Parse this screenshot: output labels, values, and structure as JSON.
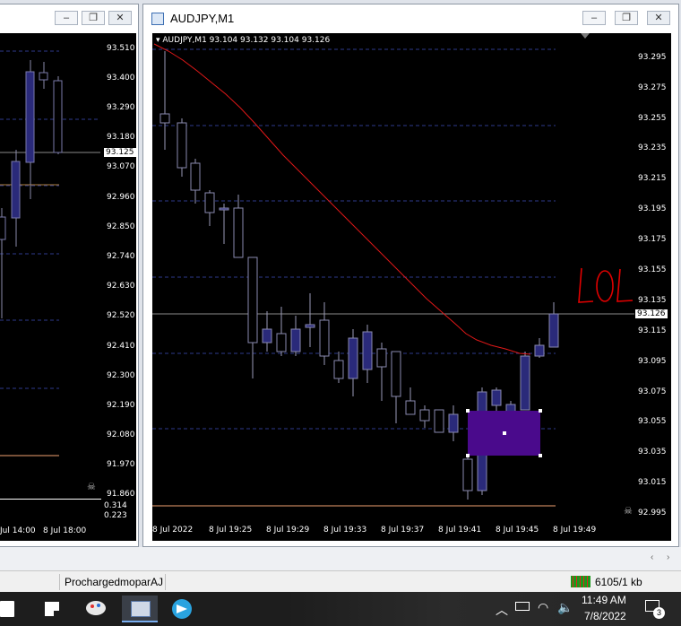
{
  "left_window": {
    "y_ticks": [
      "93.510",
      "93.400",
      "93.290",
      "93.180",
      "93.070",
      "92.960",
      "92.850",
      "92.740",
      "92.630",
      "92.520",
      "92.410",
      "92.300",
      "92.190",
      "92.080",
      "91.970",
      "91.860"
    ],
    "price_tag": "93.125",
    "x_ticks": [
      "Jul 14:00",
      "8 Jul 18:00"
    ],
    "indicator_ticks": [
      "0.314",
      "0.223"
    ]
  },
  "main_window": {
    "title": "AUDJPY,M1",
    "info_line": "AUDJPY,M1  93.104 93.132 93.104 93.126",
    "y_ticks": [
      "93.295",
      "93.275",
      "93.255",
      "93.235",
      "93.215",
      "93.195",
      "93.175",
      "93.155",
      "93.135",
      "93.115",
      "93.095",
      "93.075",
      "93.055",
      "93.035",
      "93.015",
      "92.995"
    ],
    "price_tag": "93.126",
    "x_ticks": [
      "8 Jul 2022",
      "8 Jul 19:25",
      "8 Jul 19:29",
      "8 Jul 19:33",
      "8 Jul 19:37",
      "8 Jul 19:41",
      "8 Jul 19:45",
      "8 Jul 19:49"
    ],
    "annotation": "LOL"
  },
  "window_buttons": {
    "minimize": "–",
    "restore": "❐",
    "close": "✕"
  },
  "status_bar": {
    "profile": "ProchargedmoparAJ",
    "traffic": "6105/1 kb"
  },
  "taskbar": {
    "time": "11:49 AM",
    "date": "7/8/2022",
    "notification_count": "3"
  },
  "colors": {
    "chart_bg": "#000000",
    "candle_up": "#3a3a8a",
    "ma": "#e01818",
    "rect": "#4a0a8c",
    "annotation": "#e00000"
  }
}
